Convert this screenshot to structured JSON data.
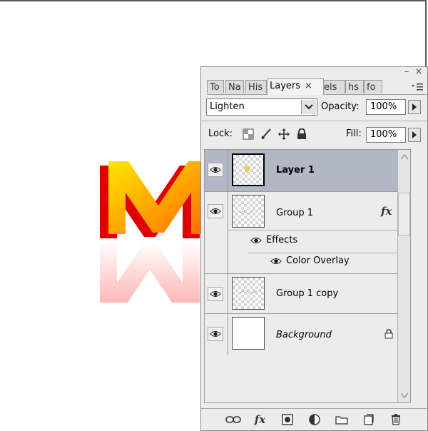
{
  "panel": {
    "tabs": [
      {
        "label": "To"
      },
      {
        "label": "Na"
      },
      {
        "label": "His"
      },
      {
        "label": "Layers"
      },
      {
        "label": "els"
      },
      {
        "label": "hs"
      },
      {
        "label": "fo"
      }
    ],
    "blend_mode": "Lighten",
    "opacity_label": "Opacity:",
    "opacity_value": "100%",
    "lock_label": "Lock:",
    "fill_label": "Fill:",
    "fill_value": "100%"
  },
  "layers": [
    {
      "name": "Layer 1",
      "selected": true,
      "visible": true
    },
    {
      "name": "Group 1",
      "visible": true,
      "has_fx": true,
      "fx_label": "fx",
      "effects": {
        "label": "Effects",
        "items": [
          "Color Overlay"
        ]
      }
    },
    {
      "name": "Group 1 copy",
      "visible": true
    },
    {
      "name": "Background",
      "visible": true,
      "locked": true
    }
  ],
  "icons": {
    "eye": "eye-icon",
    "lock": "lock-icon",
    "link": "link-layers-icon",
    "fx": "add-layer-style-icon",
    "mask": "add-mask-icon",
    "adjust": "adjustment-layer-icon",
    "group": "new-group-icon",
    "new": "new-layer-icon",
    "trash": "delete-layer-icon"
  },
  "colors": {
    "selected_row": "#b1b7c4",
    "panel_bg": "#ececec"
  }
}
